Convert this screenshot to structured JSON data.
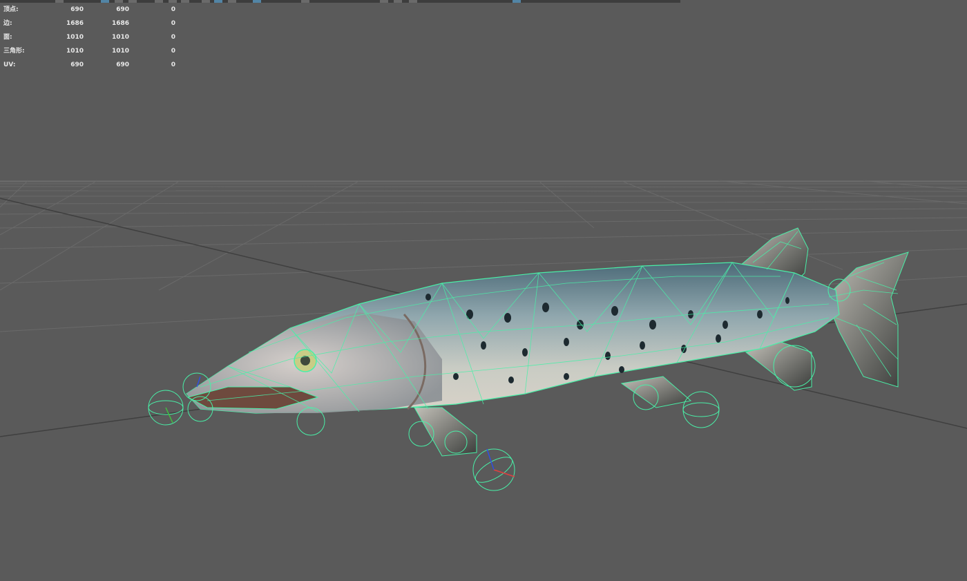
{
  "toolbar": {
    "buttons": [
      "select-tool",
      "lasso-tool",
      "paint-tool",
      "move-tool",
      "rotate-tool",
      "scale-tool",
      "snap-grid",
      "snap-curve",
      "snap-point",
      "snap-plane",
      "snap-surface",
      "history",
      "render-frame",
      "ipr-render",
      "render-settings",
      "channel-box"
    ]
  },
  "heads_up_display": {
    "rows": [
      {
        "label": "顶点:",
        "values": [
          "690",
          "690",
          "0"
        ]
      },
      {
        "label": "边:",
        "values": [
          "1686",
          "1686",
          "0"
        ]
      },
      {
        "label": "面:",
        "values": [
          "1010",
          "1010",
          "0"
        ]
      },
      {
        "label": "三角形:",
        "values": [
          "1010",
          "1010",
          "0"
        ]
      },
      {
        "label": "UV:",
        "values": [
          "690",
          "690",
          "0"
        ]
      }
    ]
  },
  "viewport": {
    "background_color": "#5a5a5a",
    "grid_color": "#6b6b6b",
    "axis_color": "#3a3a3a",
    "wireframe_color": "#49f0a8",
    "model": "pike-fish-mesh-with-joint-controls"
  }
}
